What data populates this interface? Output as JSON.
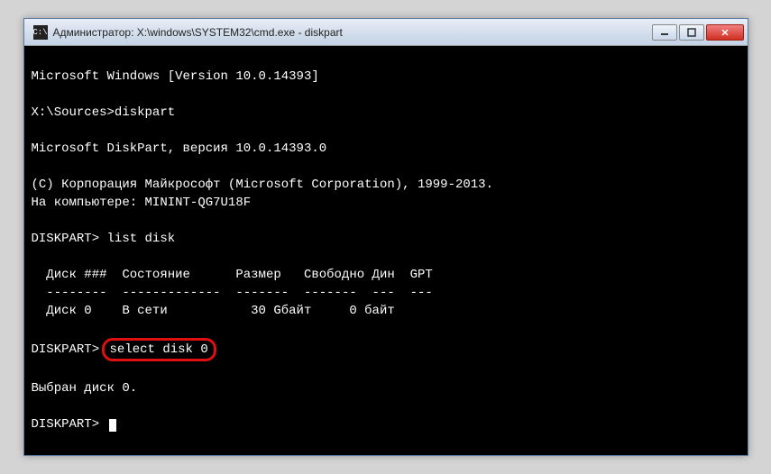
{
  "titlebar": {
    "icon_text": "C:\\",
    "title": "Администратор: X:\\windows\\SYSTEM32\\cmd.exe - diskpart"
  },
  "terminal": {
    "line_version": "Microsoft Windows [Version 10.0.14393]",
    "blank1": "",
    "prompt1": "X:\\Sources>",
    "cmd1": "diskpart",
    "blank2": "",
    "diskpart_version": "Microsoft DiskPart, версия 10.0.14393.0",
    "blank3": "",
    "copyright": "(C) Корпорация Майкрософт (Microsoft Corporation), 1999-2013.",
    "computer": "На компьютере: MININT-QG7U18F",
    "blank4": "",
    "prompt2": "DISKPART> ",
    "cmd2": "list disk",
    "blank5": "",
    "table_header": "  Диск ###  Состояние      Размер   Свободно Дин  GPT",
    "table_divider": "  --------  -------------  -------  -------  ---  ---",
    "table_row": "  Диск 0    В сети           30 Gбайт     0 байт",
    "blank6": "",
    "prompt3": "DISKPART> ",
    "cmd3": "select disk 0",
    "blank7": "",
    "result": "Выбран диск 0.",
    "blank8": "",
    "prompt4": "DISKPART> "
  }
}
